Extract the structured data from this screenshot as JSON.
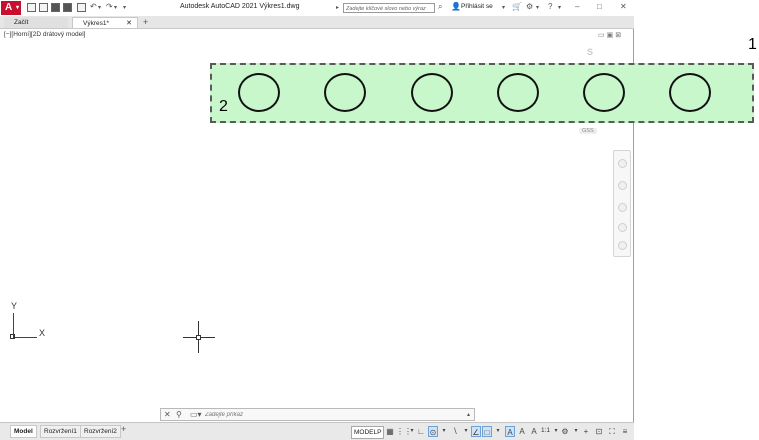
{
  "window": {
    "title": "Autodesk AutoCAD 2021    Výkres1.dwg",
    "logo_letter": "A",
    "search_placeholder": "Zadejte klíčové slovo nebo výraz",
    "login": "Přihlásit se"
  },
  "tabs": [
    {
      "label": "Začít",
      "active": false
    },
    {
      "label": "Výkres1*",
      "active": true
    }
  ],
  "viewport": {
    "label": "[−][Horní][2D drátový model]",
    "view_cube_letter": "S",
    "wcs_label": "GSS"
  },
  "annotations": {
    "callout_1": "1",
    "callout_2": "2",
    "highlight_color": "#c8f7cb"
  },
  "circles_count_visible": 6,
  "ucs": {
    "x_label": "X",
    "y_label": "Y"
  },
  "command_line": {
    "placeholder": "Zadejte příkaz"
  },
  "layout_tabs": [
    "Model",
    "Rozvržení1",
    "Rozvržení2"
  ],
  "status": {
    "space": "MODELP",
    "scale": "1:1"
  },
  "colors": {
    "brand": "#c8102e",
    "accent": "#6fa0d8"
  }
}
